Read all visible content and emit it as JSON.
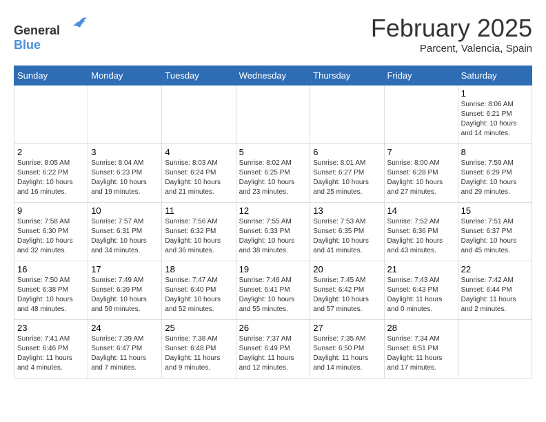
{
  "logo": {
    "general": "General",
    "blue": "Blue"
  },
  "title": "February 2025",
  "subtitle": "Parcent, Valencia, Spain",
  "days_of_week": [
    "Sunday",
    "Monday",
    "Tuesday",
    "Wednesday",
    "Thursday",
    "Friday",
    "Saturday"
  ],
  "weeks": [
    [
      {
        "day": "",
        "content": ""
      },
      {
        "day": "",
        "content": ""
      },
      {
        "day": "",
        "content": ""
      },
      {
        "day": "",
        "content": ""
      },
      {
        "day": "",
        "content": ""
      },
      {
        "day": "",
        "content": ""
      },
      {
        "day": "1",
        "content": "Sunrise: 8:06 AM\nSunset: 6:21 PM\nDaylight: 10 hours and 14 minutes."
      }
    ],
    [
      {
        "day": "2",
        "content": "Sunrise: 8:05 AM\nSunset: 6:22 PM\nDaylight: 10 hours and 16 minutes."
      },
      {
        "day": "3",
        "content": "Sunrise: 8:04 AM\nSunset: 6:23 PM\nDaylight: 10 hours and 19 minutes."
      },
      {
        "day": "4",
        "content": "Sunrise: 8:03 AM\nSunset: 6:24 PM\nDaylight: 10 hours and 21 minutes."
      },
      {
        "day": "5",
        "content": "Sunrise: 8:02 AM\nSunset: 6:25 PM\nDaylight: 10 hours and 23 minutes."
      },
      {
        "day": "6",
        "content": "Sunrise: 8:01 AM\nSunset: 6:27 PM\nDaylight: 10 hours and 25 minutes."
      },
      {
        "day": "7",
        "content": "Sunrise: 8:00 AM\nSunset: 6:28 PM\nDaylight: 10 hours and 27 minutes."
      },
      {
        "day": "8",
        "content": "Sunrise: 7:59 AM\nSunset: 6:29 PM\nDaylight: 10 hours and 29 minutes."
      }
    ],
    [
      {
        "day": "9",
        "content": "Sunrise: 7:58 AM\nSunset: 6:30 PM\nDaylight: 10 hours and 32 minutes."
      },
      {
        "day": "10",
        "content": "Sunrise: 7:57 AM\nSunset: 6:31 PM\nDaylight: 10 hours and 34 minutes."
      },
      {
        "day": "11",
        "content": "Sunrise: 7:56 AM\nSunset: 6:32 PM\nDaylight: 10 hours and 36 minutes."
      },
      {
        "day": "12",
        "content": "Sunrise: 7:55 AM\nSunset: 6:33 PM\nDaylight: 10 hours and 38 minutes."
      },
      {
        "day": "13",
        "content": "Sunrise: 7:53 AM\nSunset: 6:35 PM\nDaylight: 10 hours and 41 minutes."
      },
      {
        "day": "14",
        "content": "Sunrise: 7:52 AM\nSunset: 6:36 PM\nDaylight: 10 hours and 43 minutes."
      },
      {
        "day": "15",
        "content": "Sunrise: 7:51 AM\nSunset: 6:37 PM\nDaylight: 10 hours and 45 minutes."
      }
    ],
    [
      {
        "day": "16",
        "content": "Sunrise: 7:50 AM\nSunset: 6:38 PM\nDaylight: 10 hours and 48 minutes."
      },
      {
        "day": "17",
        "content": "Sunrise: 7:49 AM\nSunset: 6:39 PM\nDaylight: 10 hours and 50 minutes."
      },
      {
        "day": "18",
        "content": "Sunrise: 7:47 AM\nSunset: 6:40 PM\nDaylight: 10 hours and 52 minutes."
      },
      {
        "day": "19",
        "content": "Sunrise: 7:46 AM\nSunset: 6:41 PM\nDaylight: 10 hours and 55 minutes."
      },
      {
        "day": "20",
        "content": "Sunrise: 7:45 AM\nSunset: 6:42 PM\nDaylight: 10 hours and 57 minutes."
      },
      {
        "day": "21",
        "content": "Sunrise: 7:43 AM\nSunset: 6:43 PM\nDaylight: 11 hours and 0 minutes."
      },
      {
        "day": "22",
        "content": "Sunrise: 7:42 AM\nSunset: 6:44 PM\nDaylight: 11 hours and 2 minutes."
      }
    ],
    [
      {
        "day": "23",
        "content": "Sunrise: 7:41 AM\nSunset: 6:46 PM\nDaylight: 11 hours and 4 minutes."
      },
      {
        "day": "24",
        "content": "Sunrise: 7:39 AM\nSunset: 6:47 PM\nDaylight: 11 hours and 7 minutes."
      },
      {
        "day": "25",
        "content": "Sunrise: 7:38 AM\nSunset: 6:48 PM\nDaylight: 11 hours and 9 minutes."
      },
      {
        "day": "26",
        "content": "Sunrise: 7:37 AM\nSunset: 6:49 PM\nDaylight: 11 hours and 12 minutes."
      },
      {
        "day": "27",
        "content": "Sunrise: 7:35 AM\nSunset: 6:50 PM\nDaylight: 11 hours and 14 minutes."
      },
      {
        "day": "28",
        "content": "Sunrise: 7:34 AM\nSunset: 6:51 PM\nDaylight: 11 hours and 17 minutes."
      },
      {
        "day": "",
        "content": ""
      }
    ]
  ]
}
